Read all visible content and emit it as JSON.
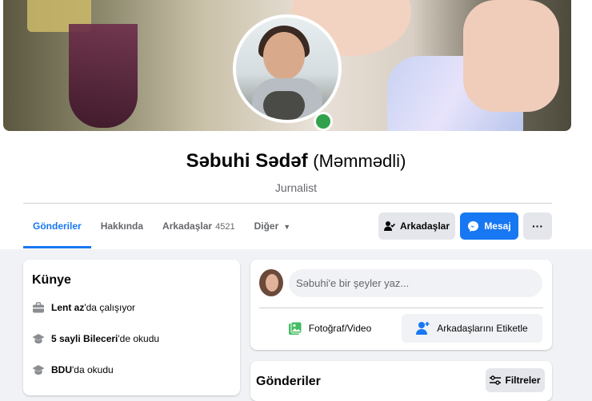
{
  "profile": {
    "name": "Səbuhi Sədəf",
    "alternate_name": "(Məmmədli)",
    "bio": "Jurnalist"
  },
  "tabs": [
    {
      "label": "Gönderiler",
      "active": true
    },
    {
      "label": "Hakkında"
    },
    {
      "label": "Arkadaşlar",
      "count": "4521"
    },
    {
      "label": "Diğer"
    }
  ],
  "actions": {
    "friends_label": "Arkadaşlar",
    "message_label": "Mesaj",
    "more_label": "···"
  },
  "intro": {
    "title": "Künye",
    "items": [
      {
        "icon": "briefcase-icon",
        "strong": "Lent az",
        "rest": "'da çalışıyor"
      },
      {
        "icon": "graduation-cap-icon",
        "strong": "5 sayli Bileceri",
        "rest": "'de okudu"
      },
      {
        "icon": "graduation-cap-icon",
        "strong": "BDU",
        "rest": "'da okudu"
      }
    ]
  },
  "composer": {
    "placeholder": "Səbuhi'e bir şeyler yaz...",
    "photo_label": "Fotoğraf/Video",
    "tag_label": "Arkadaşlarını Etiketle"
  },
  "posts": {
    "title": "Gönderiler",
    "filter_label": "Filtreler"
  },
  "colors": {
    "accent": "#1877f2",
    "online": "#31a24c",
    "photo_icon": "#45bd62"
  }
}
